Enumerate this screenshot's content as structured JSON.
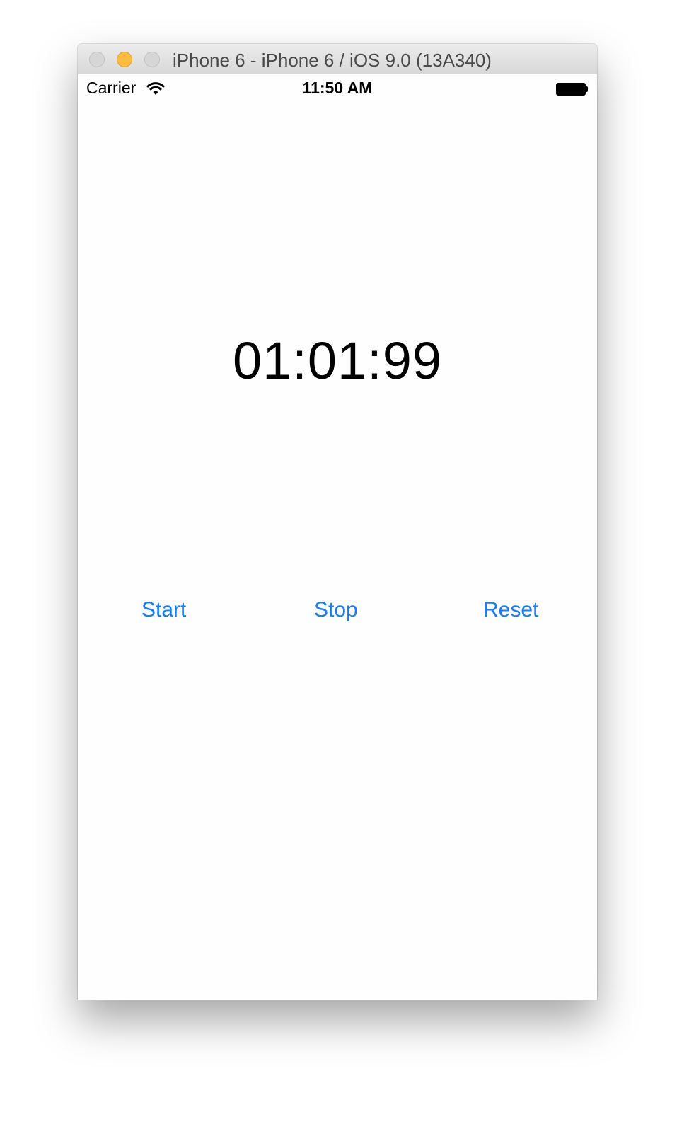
{
  "window": {
    "title": "iPhone 6 - iPhone 6 / iOS 9.0 (13A340)"
  },
  "status_bar": {
    "carrier": "Carrier",
    "time": "11:50 AM",
    "wifi_icon": "wifi-icon",
    "battery_icon": "battery-icon"
  },
  "stopwatch": {
    "display": "01:01:99"
  },
  "controls": {
    "start_label": "Start",
    "stop_label": "Stop",
    "reset_label": "Reset"
  },
  "colors": {
    "accent": "#1a7cf0",
    "minimize_button": "#fdbb40"
  }
}
